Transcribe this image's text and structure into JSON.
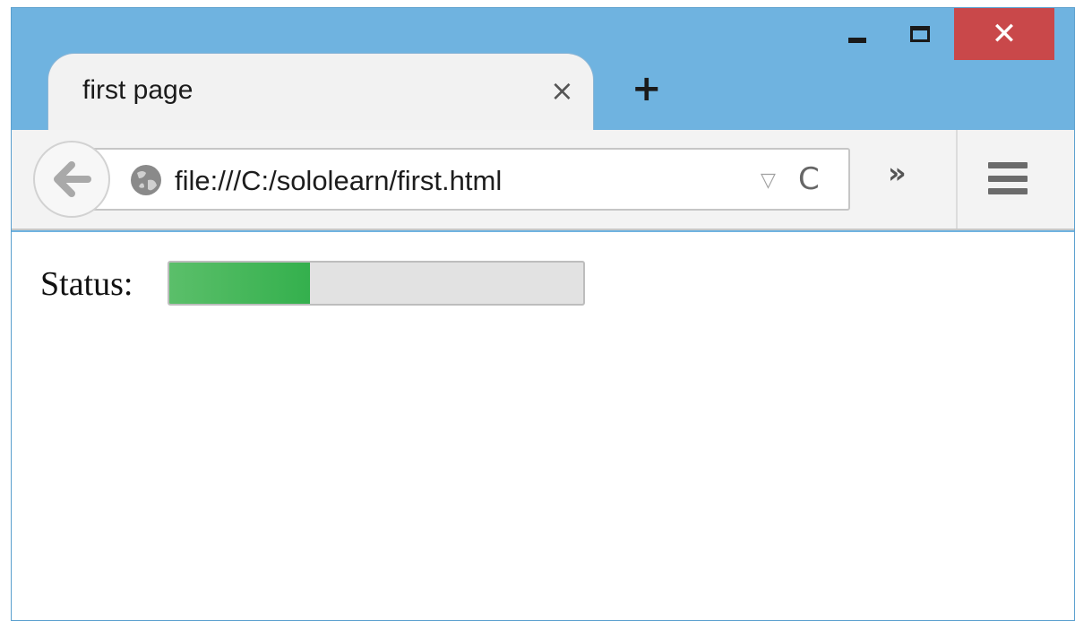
{
  "window": {
    "controls": [
      "minimize",
      "maximize",
      "close"
    ],
    "close_color": "#c9484a",
    "frame_color": "#6fb3e0"
  },
  "tabs": [
    {
      "label": "first page",
      "active": true
    }
  ],
  "tab_close_glyph": "×",
  "new_tab_glyph": "+",
  "toolbar": {
    "back_icon": "back-arrow-icon",
    "site_icon": "globe-icon",
    "url": "file:///C:/sololearn/first.html",
    "dropdown_glyph": "▽",
    "reload_glyph": "C",
    "overflow_glyph": "»",
    "menu_icon": "hamburger-menu-icon"
  },
  "content": {
    "status_label": "Status:",
    "progress": {
      "value": 0.34,
      "fill_color": "#34b04d"
    }
  }
}
